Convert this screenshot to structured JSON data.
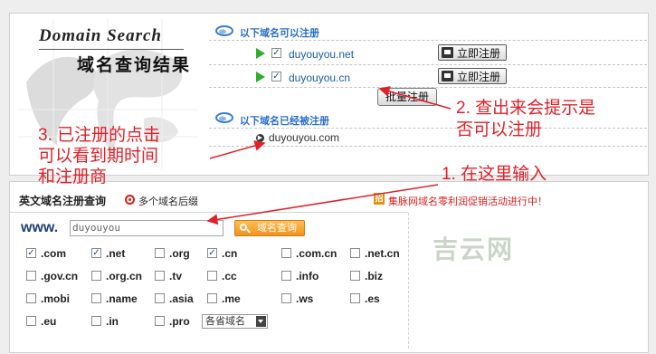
{
  "result": {
    "logo_en": "Domain Search",
    "logo_cn": "域名查询结果",
    "available_title": "以下域名可以注册",
    "available": [
      {
        "domain": "duyouyou.net",
        "checked": true,
        "button": "立即注册"
      },
      {
        "domain": "duyouyou.cn",
        "checked": true,
        "button": "立即注册"
      }
    ],
    "batch_button": "批量注册",
    "registered_title": "以下域名已经被注册",
    "registered": [
      {
        "domain": "duyouyou.com"
      }
    ]
  },
  "query": {
    "tab_label": "英文域名注册查询",
    "multi_suffix_label": "多个域名后缀",
    "promo_icon": "招",
    "promo_text": "集脉网域名零利润促销活动进行中！",
    "www_label": "www.",
    "input_value": "duyouyou",
    "query_button": "域名查询",
    "tlds": [
      [
        {
          "label": ".com",
          "checked": true
        },
        {
          "label": ".net",
          "checked": true
        },
        {
          "label": ".org",
          "checked": false
        },
        {
          "label": ".cn",
          "checked": true
        },
        {
          "label": ".com.cn",
          "checked": false
        },
        {
          "label": ".net.cn",
          "checked": false
        }
      ],
      [
        {
          "label": ".gov.cn",
          "checked": false
        },
        {
          "label": ".org.cn",
          "checked": false
        },
        {
          "label": ".tv",
          "checked": false
        },
        {
          "label": ".cc",
          "checked": false
        },
        {
          "label": ".info",
          "checked": false
        },
        {
          "label": ".biz",
          "checked": false
        }
      ],
      [
        {
          "label": ".mobi",
          "checked": false
        },
        {
          "label": ".name",
          "checked": false
        },
        {
          "label": ".asia",
          "checked": false
        },
        {
          "label": ".me",
          "checked": false
        },
        {
          "label": ".ws",
          "checked": false
        },
        {
          "label": ".es",
          "checked": false
        }
      ],
      [
        {
          "label": ".eu",
          "checked": false
        },
        {
          "label": ".in",
          "checked": false
        },
        {
          "label": ".pro",
          "checked": false
        }
      ]
    ],
    "region_select": "各省域名"
  },
  "annotations": {
    "note1": "1. 在这里输入",
    "note2_line1": "2. 查出来会提示是",
    "note2_line2": "否可以注册",
    "note3_line1": "3. 已注册的点击",
    "note3_line2": "可以看到期时间",
    "note3_line3": "和注册商"
  },
  "watermark": "吉云网",
  "colors": {
    "annotation": "#e0212a",
    "link": "#1a5ea8",
    "section_title": "#2a6fc9",
    "promo": "#d81f1f"
  }
}
